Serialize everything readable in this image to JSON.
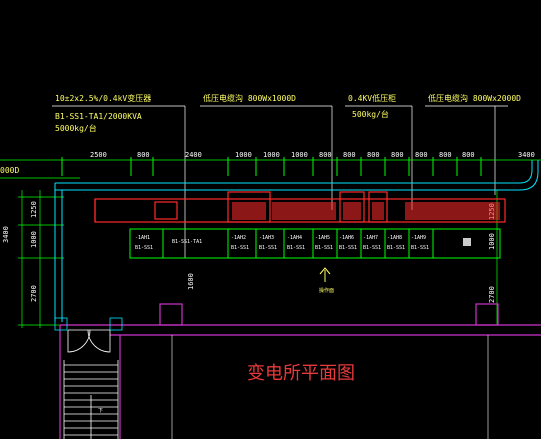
{
  "annotations": {
    "transformer_spec": "10±2x2.5%/0.4kV变压器",
    "transformer_model": "B1-SS1-TA1/2000KVA",
    "transformer_weight": "5000kg/台",
    "lv_trunk_1": "低压电缆沟 800Wx1000D",
    "lv_cabinet": "0.4KV低压柜",
    "lv_cabinet_weight": "500kg/台",
    "lv_trunk_2": "低压电缆沟 800Wx2000D",
    "left_cut_label": "000D"
  },
  "dimensions": {
    "top": [
      "2500",
      "800",
      "2400",
      "1000",
      "1000",
      "1000",
      "800",
      "800",
      "800",
      "800",
      "800",
      "800",
      "800",
      "3400"
    ],
    "left": [
      "1250",
      "1000",
      "2700"
    ],
    "mid": "1600"
  },
  "cabinet_labels": [
    {
      "top": "-1AH1",
      "bot": "B1-SS1"
    },
    {
      "top": "B1-SS1-TA1",
      "bot": ""
    },
    {
      "top": "-1AH2",
      "bot": "B1-SS1"
    },
    {
      "top": "-1AH3",
      "bot": "B1-SS1"
    },
    {
      "top": "-1AH4",
      "bot": "B1-SS1"
    },
    {
      "top": "-1AH5",
      "bot": "B1-SS1"
    },
    {
      "top": "-1AH6",
      "bot": "B1-SS1"
    },
    {
      "top": "-1AH7",
      "bot": "B1-SS1"
    },
    {
      "top": "-1AH8",
      "bot": "B1-SS1"
    },
    {
      "top": "-1AH9",
      "bot": "B1-SS1"
    }
  ],
  "north_label": "操作面",
  "stair_label": "下",
  "plan_title": "变电所平面图",
  "colors": {
    "background": "#000000",
    "annotation": "#ffff66",
    "dimension": "#00ff00",
    "equipment": "#ff2a2a",
    "wall": "#cc33cc",
    "cable": "#00e5ff",
    "title": "#e83a3a"
  }
}
